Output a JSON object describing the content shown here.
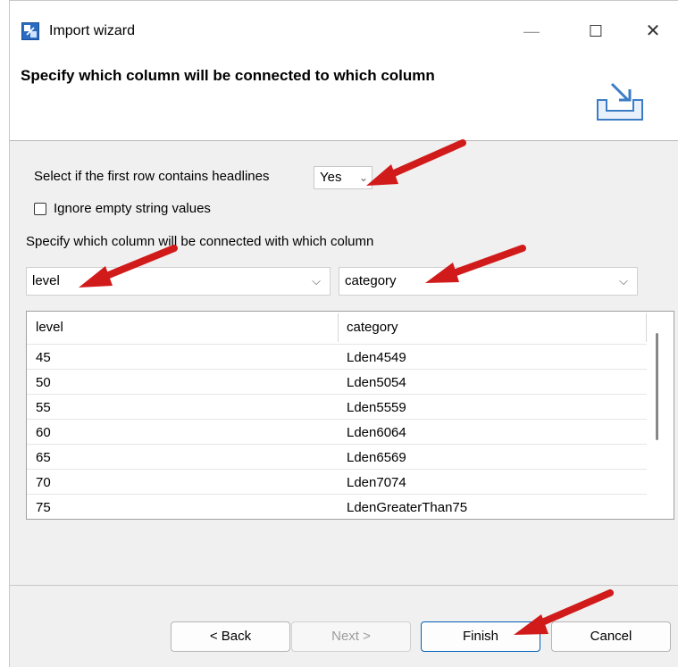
{
  "window": {
    "title": "Import wizard",
    "minimize_glyph": "—",
    "maximize_glyph": "☐",
    "close_glyph": "✕",
    "app_icon": "import-wizard-icon"
  },
  "header": {
    "title": "Specify which column will be connected to which column",
    "icon": "import-tray-icon"
  },
  "headlines": {
    "label": "Select if the first row contains headlines",
    "value": "Yes"
  },
  "ignore_empty": {
    "label": "Ignore empty string values",
    "checked": false
  },
  "mapping": {
    "label": "Specify which column will be connected with which column",
    "left_value": "level",
    "right_value": "category"
  },
  "table": {
    "columns": [
      "level",
      "category"
    ],
    "rows": [
      [
        "45",
        "Lden4549"
      ],
      [
        "50",
        "Lden5054"
      ],
      [
        "55",
        "Lden5559"
      ],
      [
        "60",
        "Lden6064"
      ],
      [
        "65",
        "Lden6569"
      ],
      [
        "70",
        "Lden7074"
      ],
      [
        "75",
        "LdenGreaterThan75"
      ]
    ]
  },
  "buttons": {
    "back": "< Back",
    "next": "Next >",
    "finish": "Finish",
    "cancel": "Cancel"
  },
  "colors": {
    "annotation_arrow": "#d11a1a",
    "default_button_border": "#005fb8"
  }
}
